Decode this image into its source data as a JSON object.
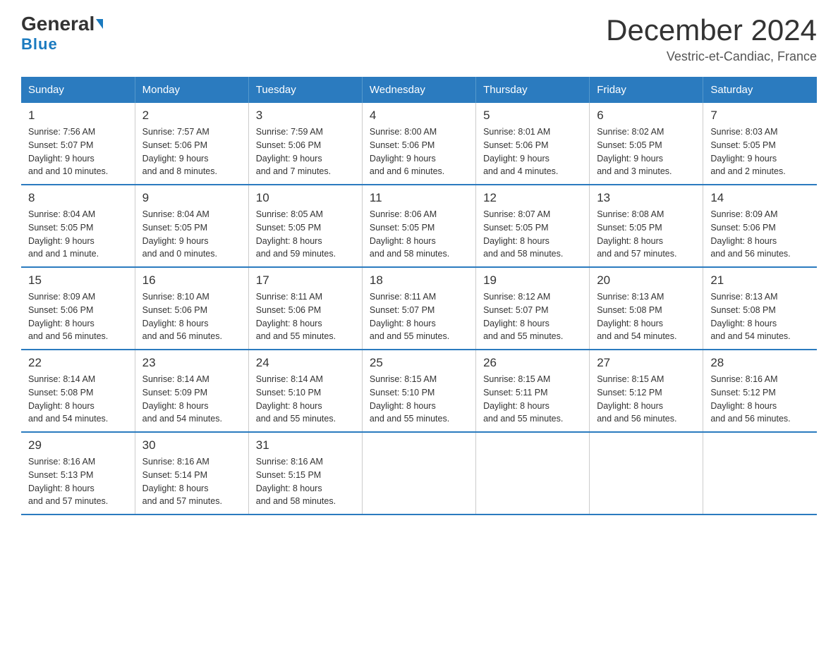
{
  "header": {
    "logo_general": "General",
    "logo_blue": "Blue",
    "month_title": "December 2024",
    "location": "Vestric-et-Candiac, France"
  },
  "days_of_week": [
    "Sunday",
    "Monday",
    "Tuesday",
    "Wednesday",
    "Thursday",
    "Friday",
    "Saturday"
  ],
  "weeks": [
    [
      {
        "day": "1",
        "sunrise": "7:56 AM",
        "sunset": "5:07 PM",
        "daylight": "9 hours and 10 minutes."
      },
      {
        "day": "2",
        "sunrise": "7:57 AM",
        "sunset": "5:06 PM",
        "daylight": "9 hours and 8 minutes."
      },
      {
        "day": "3",
        "sunrise": "7:59 AM",
        "sunset": "5:06 PM",
        "daylight": "9 hours and 7 minutes."
      },
      {
        "day": "4",
        "sunrise": "8:00 AM",
        "sunset": "5:06 PM",
        "daylight": "9 hours and 6 minutes."
      },
      {
        "day": "5",
        "sunrise": "8:01 AM",
        "sunset": "5:06 PM",
        "daylight": "9 hours and 4 minutes."
      },
      {
        "day": "6",
        "sunrise": "8:02 AM",
        "sunset": "5:05 PM",
        "daylight": "9 hours and 3 minutes."
      },
      {
        "day": "7",
        "sunrise": "8:03 AM",
        "sunset": "5:05 PM",
        "daylight": "9 hours and 2 minutes."
      }
    ],
    [
      {
        "day": "8",
        "sunrise": "8:04 AM",
        "sunset": "5:05 PM",
        "daylight": "9 hours and 1 minute."
      },
      {
        "day": "9",
        "sunrise": "8:04 AM",
        "sunset": "5:05 PM",
        "daylight": "9 hours and 0 minutes."
      },
      {
        "day": "10",
        "sunrise": "8:05 AM",
        "sunset": "5:05 PM",
        "daylight": "8 hours and 59 minutes."
      },
      {
        "day": "11",
        "sunrise": "8:06 AM",
        "sunset": "5:05 PM",
        "daylight": "8 hours and 58 minutes."
      },
      {
        "day": "12",
        "sunrise": "8:07 AM",
        "sunset": "5:05 PM",
        "daylight": "8 hours and 58 minutes."
      },
      {
        "day": "13",
        "sunrise": "8:08 AM",
        "sunset": "5:05 PM",
        "daylight": "8 hours and 57 minutes."
      },
      {
        "day": "14",
        "sunrise": "8:09 AM",
        "sunset": "5:06 PM",
        "daylight": "8 hours and 56 minutes."
      }
    ],
    [
      {
        "day": "15",
        "sunrise": "8:09 AM",
        "sunset": "5:06 PM",
        "daylight": "8 hours and 56 minutes."
      },
      {
        "day": "16",
        "sunrise": "8:10 AM",
        "sunset": "5:06 PM",
        "daylight": "8 hours and 56 minutes."
      },
      {
        "day": "17",
        "sunrise": "8:11 AM",
        "sunset": "5:06 PM",
        "daylight": "8 hours and 55 minutes."
      },
      {
        "day": "18",
        "sunrise": "8:11 AM",
        "sunset": "5:07 PM",
        "daylight": "8 hours and 55 minutes."
      },
      {
        "day": "19",
        "sunrise": "8:12 AM",
        "sunset": "5:07 PM",
        "daylight": "8 hours and 55 minutes."
      },
      {
        "day": "20",
        "sunrise": "8:13 AM",
        "sunset": "5:08 PM",
        "daylight": "8 hours and 54 minutes."
      },
      {
        "day": "21",
        "sunrise": "8:13 AM",
        "sunset": "5:08 PM",
        "daylight": "8 hours and 54 minutes."
      }
    ],
    [
      {
        "day": "22",
        "sunrise": "8:14 AM",
        "sunset": "5:08 PM",
        "daylight": "8 hours and 54 minutes."
      },
      {
        "day": "23",
        "sunrise": "8:14 AM",
        "sunset": "5:09 PM",
        "daylight": "8 hours and 54 minutes."
      },
      {
        "day": "24",
        "sunrise": "8:14 AM",
        "sunset": "5:10 PM",
        "daylight": "8 hours and 55 minutes."
      },
      {
        "day": "25",
        "sunrise": "8:15 AM",
        "sunset": "5:10 PM",
        "daylight": "8 hours and 55 minutes."
      },
      {
        "day": "26",
        "sunrise": "8:15 AM",
        "sunset": "5:11 PM",
        "daylight": "8 hours and 55 minutes."
      },
      {
        "day": "27",
        "sunrise": "8:15 AM",
        "sunset": "5:12 PM",
        "daylight": "8 hours and 56 minutes."
      },
      {
        "day": "28",
        "sunrise": "8:16 AM",
        "sunset": "5:12 PM",
        "daylight": "8 hours and 56 minutes."
      }
    ],
    [
      {
        "day": "29",
        "sunrise": "8:16 AM",
        "sunset": "5:13 PM",
        "daylight": "8 hours and 57 minutes."
      },
      {
        "day": "30",
        "sunrise": "8:16 AM",
        "sunset": "5:14 PM",
        "daylight": "8 hours and 57 minutes."
      },
      {
        "day": "31",
        "sunrise": "8:16 AM",
        "sunset": "5:15 PM",
        "daylight": "8 hours and 58 minutes."
      },
      null,
      null,
      null,
      null
    ]
  ],
  "labels": {
    "sunrise": "Sunrise:",
    "sunset": "Sunset:",
    "daylight": "Daylight:"
  }
}
